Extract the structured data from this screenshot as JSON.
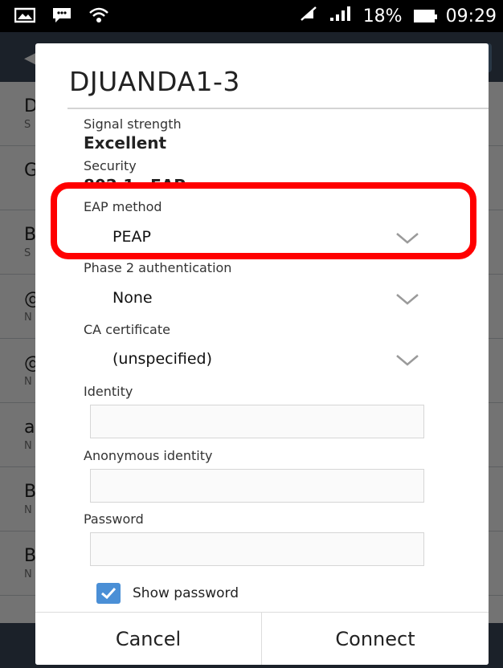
{
  "status_bar": {
    "battery_percent": "18%",
    "time": "09:29",
    "icons": [
      "gallery-icon",
      "bbm-icon",
      "wifi-icon",
      "no-sim-icon",
      "signal-icon",
      "battery-icon"
    ]
  },
  "background": {
    "list_initials": [
      "D",
      "G",
      "B",
      "@",
      "@",
      "a",
      "B",
      "B"
    ],
    "list_sub_initials": [
      "S",
      "",
      "S",
      "N",
      "N",
      "N",
      "N",
      "N"
    ]
  },
  "dialog": {
    "title": "DJUANDA1-3",
    "signal_strength_label": "Signal strength",
    "signal_strength_value": "Excellent",
    "security_label": "Security",
    "security_value": "802.1x EAP",
    "eap_method_label": "EAP method",
    "eap_method_value": "PEAP",
    "phase2_label": "Phase 2 authentication",
    "phase2_value": "None",
    "ca_cert_label": "CA certificate",
    "ca_cert_value": "(unspecified)",
    "identity_label": "Identity",
    "identity_value": "",
    "anonymous_identity_label": "Anonymous identity",
    "anonymous_identity_value": "",
    "password_label": "Password",
    "password_value": "",
    "show_password_label": "Show password",
    "show_password_checked": true,
    "cancel_label": "Cancel",
    "connect_label": "Connect"
  },
  "colors": {
    "highlight": "#ff0000",
    "checkbox": "#4a8fd6",
    "header": "#3c4a5c"
  }
}
